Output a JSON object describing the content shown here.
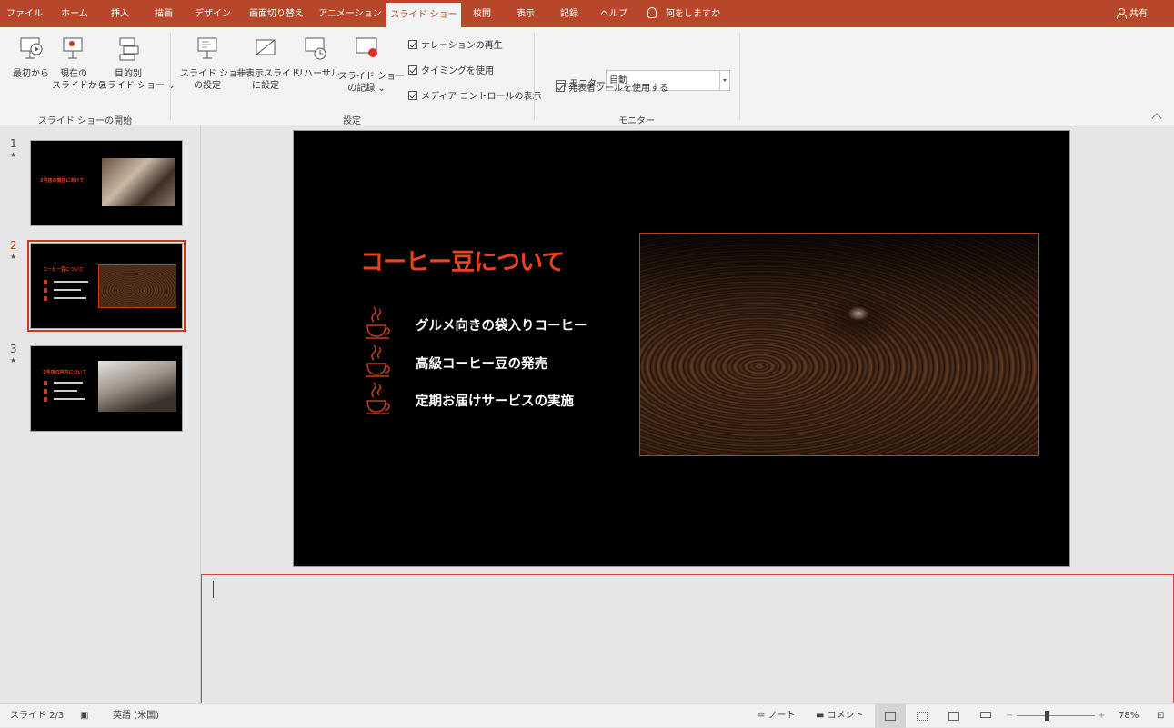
{
  "ribbon_tabs": [
    "ファイル",
    "ホーム",
    "挿入",
    "描画",
    "デザイン",
    "画面切り替え",
    "アニメーション",
    "スライド ショー",
    "校閲",
    "表示",
    "記録",
    "ヘルプ"
  ],
  "tell_me": "何をしますか",
  "share": "共有",
  "groups": {
    "start": {
      "label": "スライド ショーの開始",
      "from_beginning": "最初から",
      "from_current_1": "現在の",
      "from_current_2": "スライドから",
      "custom_1": "目的別",
      "custom_2": "スライド ショー"
    },
    "setup": {
      "label": "設定",
      "setup_1": "スライド ショー",
      "setup_2": "の設定",
      "hide_1": "非表示スライド",
      "hide_2": "に設定",
      "rehearse": "リハーサル",
      "record_1": "スライド ショー",
      "record_2": "の記録",
      "chk_narration": "ナレーションの再生",
      "chk_timing": "タイミングを使用",
      "chk_media": "メディア コントロールの表示"
    },
    "monitors": {
      "label": "モニター",
      "monitor_label": "モニター:",
      "monitor_value": "自動",
      "chk_presenter": "発表者ツールを使用する"
    }
  },
  "thumbnails": [
    {
      "num": "1",
      "title": "2号店の開店に向けて"
    },
    {
      "num": "2",
      "title": "コーヒー豆について"
    },
    {
      "num": "3",
      "title": "2号店の店内について"
    }
  ],
  "slide": {
    "title": "コーヒー豆について",
    "bullets": [
      "グルメ向きの袋入りコーヒー",
      "高級コーヒー豆の発売",
      "定期お届けサービスの実施"
    ]
  },
  "status": {
    "slide_pos": "スライド 2/3",
    "language": "英語 (米国)",
    "notes": "ノート",
    "comments": "コメント",
    "zoom": "78%"
  },
  "colors": {
    "ribbon_tab_bg": "#b7472a",
    "accent": "#e8441a",
    "slide_bg": "#000000"
  }
}
